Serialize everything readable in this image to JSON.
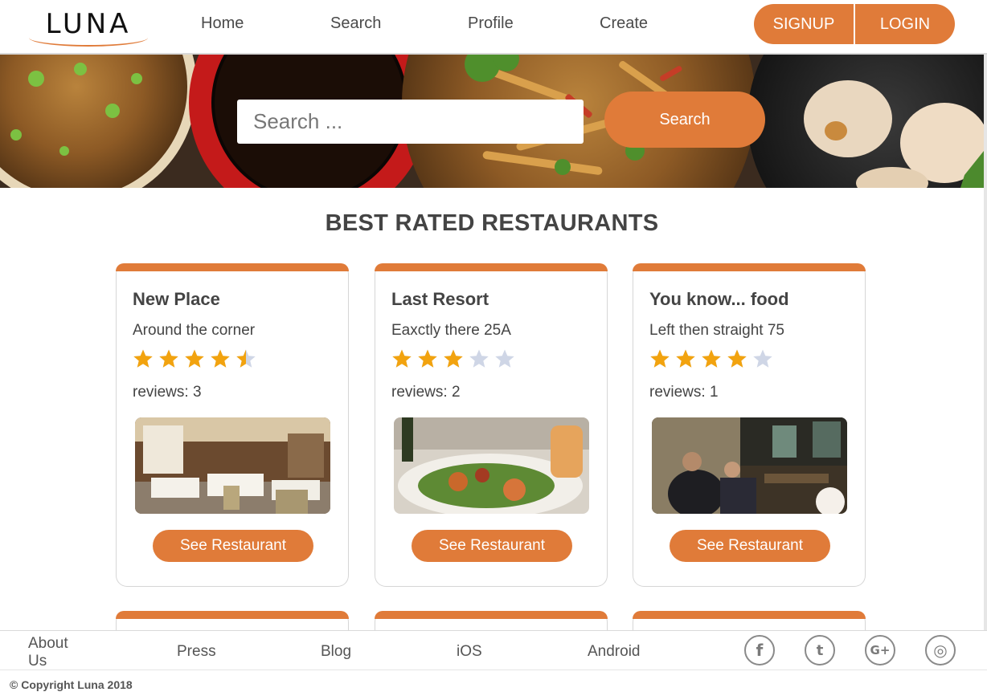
{
  "brand": {
    "logo_text": "LUNA",
    "accent_color": "#e07b39"
  },
  "nav": {
    "items": [
      {
        "label": "Home"
      },
      {
        "label": "Search"
      },
      {
        "label": "Profile"
      },
      {
        "label": "Create"
      }
    ],
    "signup_label": "SIGNUP",
    "login_label": "LOGIN"
  },
  "hero": {
    "search_placeholder": "Search ...",
    "search_button": "Search"
  },
  "section": {
    "title": "BEST RATED RESTAURANTS"
  },
  "restaurants": [
    {
      "name": "New Place",
      "address": "Around the corner",
      "rating": 4.5,
      "reviews_text": "reviews: 3",
      "button": "See Restaurant"
    },
    {
      "name": "Last Resort",
      "address": "Eaxctly there 25A",
      "rating": 3,
      "reviews_text": "reviews: 2",
      "button": "See Restaurant"
    },
    {
      "name": "You know... food",
      "address": "Left then straight 75",
      "rating": 4,
      "reviews_text": "reviews: 1",
      "button": "See Restaurant"
    }
  ],
  "footer": {
    "links": [
      {
        "label": "About Us"
      },
      {
        "label": "Press"
      },
      {
        "label": "Blog"
      },
      {
        "label": "iOS"
      },
      {
        "label": "Android"
      }
    ],
    "social": [
      {
        "icon": "facebook-icon",
        "glyph": "f"
      },
      {
        "icon": "twitter-icon",
        "glyph": "t"
      },
      {
        "icon": "google-plus-icon",
        "glyph": "G+"
      },
      {
        "icon": "instagram-icon",
        "glyph": "◎"
      }
    ],
    "copyright": "© Copyright Luna 2018"
  }
}
